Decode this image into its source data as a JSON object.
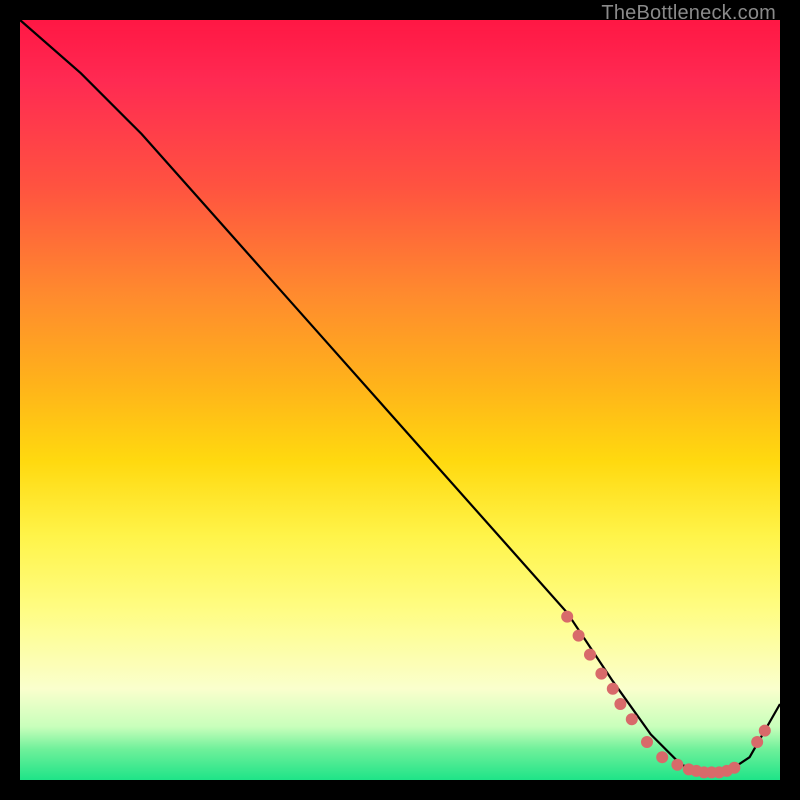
{
  "watermark": "TheBottleneck.com",
  "chart_data": {
    "type": "line",
    "title": "",
    "xlabel": "",
    "ylabel": "",
    "xlim": [
      0,
      100
    ],
    "ylim": [
      0,
      100
    ],
    "grid": false,
    "legend": false,
    "series": [
      {
        "name": "curve",
        "x": [
          0,
          8,
          16,
          24,
          32,
          40,
          48,
          56,
          64,
          72,
          78,
          83,
          87,
          90,
          93,
          96,
          100
        ],
        "y": [
          100,
          93,
          85,
          76,
          67,
          58,
          49,
          40,
          31,
          22,
          13,
          6,
          2,
          1,
          1,
          3,
          10
        ]
      }
    ],
    "markers": [
      {
        "x": 72.0,
        "y": 21.5
      },
      {
        "x": 73.5,
        "y": 19.0
      },
      {
        "x": 75.0,
        "y": 16.5
      },
      {
        "x": 76.5,
        "y": 14.0
      },
      {
        "x": 78.0,
        "y": 12.0
      },
      {
        "x": 79.0,
        "y": 10.0
      },
      {
        "x": 80.5,
        "y": 8.0
      },
      {
        "x": 82.5,
        "y": 5.0
      },
      {
        "x": 84.5,
        "y": 3.0
      },
      {
        "x": 86.5,
        "y": 2.0
      },
      {
        "x": 88.0,
        "y": 1.4
      },
      {
        "x": 89.0,
        "y": 1.2
      },
      {
        "x": 90.0,
        "y": 1.0
      },
      {
        "x": 91.0,
        "y": 1.0
      },
      {
        "x": 92.0,
        "y": 1.0
      },
      {
        "x": 93.0,
        "y": 1.2
      },
      {
        "x": 94.0,
        "y": 1.6
      },
      {
        "x": 97.0,
        "y": 5.0
      },
      {
        "x": 98.0,
        "y": 6.5
      }
    ],
    "marker_color": "#d86a6a",
    "curve_color": "#000000"
  }
}
